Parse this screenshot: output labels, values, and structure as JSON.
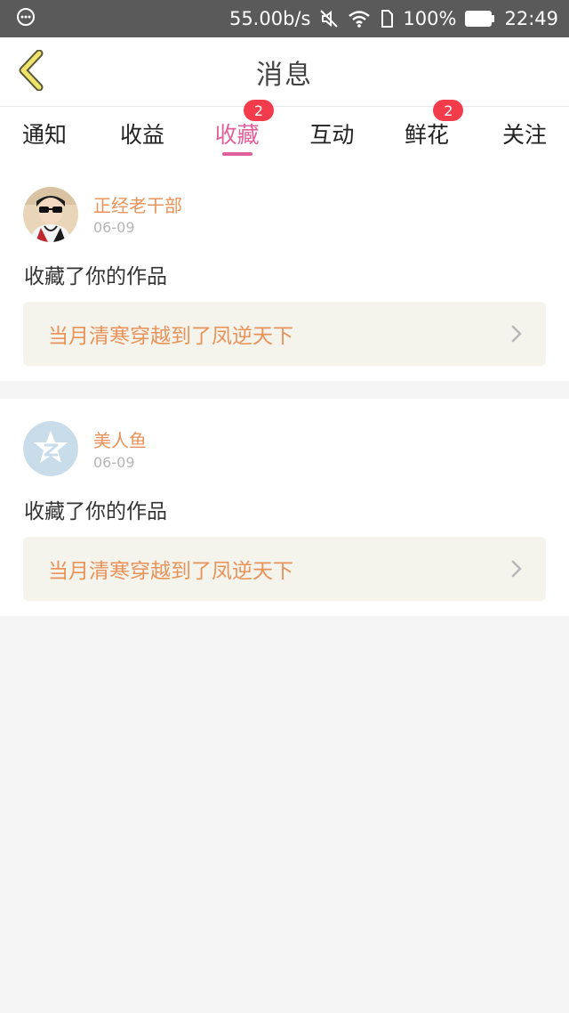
{
  "status_bar": {
    "speed": "55.00b/s",
    "battery": "100%",
    "time": "22:49"
  },
  "header": {
    "title": "消息"
  },
  "tabs": [
    {
      "label": "通知",
      "active": false,
      "badge": ""
    },
    {
      "label": "收益",
      "active": false,
      "badge": ""
    },
    {
      "label": "收藏",
      "active": true,
      "badge": "2"
    },
    {
      "label": "互动",
      "active": false,
      "badge": ""
    },
    {
      "label": "鲜花",
      "active": false,
      "badge": "2"
    },
    {
      "label": "关注",
      "active": false,
      "badge": ""
    }
  ],
  "colors": {
    "accent_pink": "#e0609a",
    "orange_text": "#e8935a",
    "badge_red": "#f23b4b",
    "link_bg": "#f4f3ec"
  },
  "messages": [
    {
      "username": "正经老干部",
      "date": "06-09",
      "action": "收藏了你的作品",
      "work_title": "当月清寒穿越到了凤逆天下",
      "avatar_icon": "user-photo-avatar"
    },
    {
      "username": "美人鱼",
      "date": "06-09",
      "action": "收藏了你的作品",
      "work_title": "当月清寒穿越到了凤逆天下",
      "avatar_icon": "default-z-avatar-icon"
    }
  ]
}
